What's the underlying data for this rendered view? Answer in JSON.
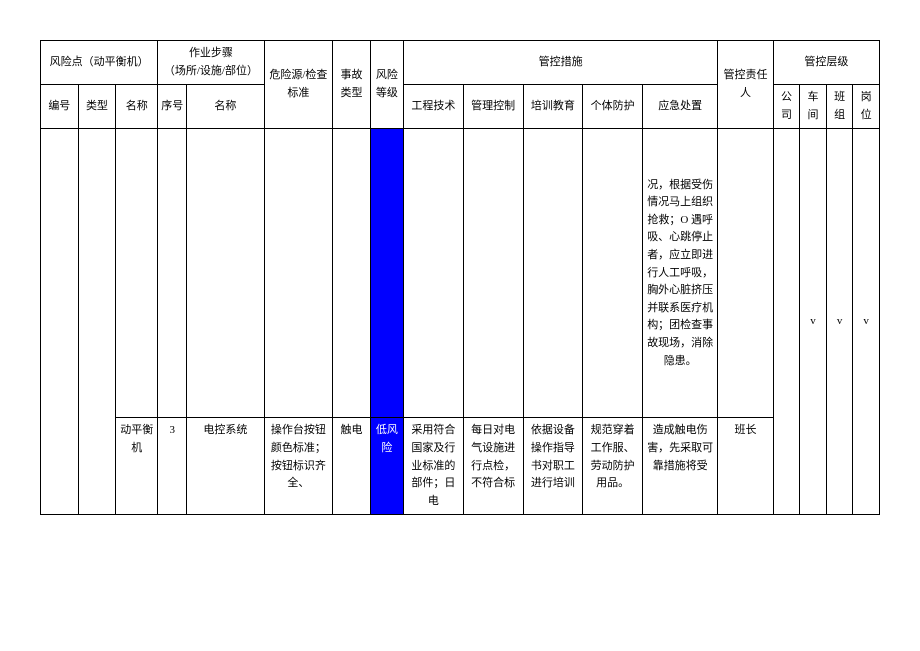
{
  "header": {
    "risk_point_group": "风险点（动平衡机）",
    "operation_steps_group": "作业步骤\n（场所/设施/部位）",
    "hazard_check_standard": "危险源/检查标准",
    "accident_type": "事故类型",
    "risk_level": "风险等级",
    "control_measures_group": "管控措施",
    "control_responsible": "管控责任人",
    "control_level_group": "管控层级",
    "number": "编号",
    "type": "类型",
    "name": "名称",
    "seq": "序号",
    "step_name": "名称",
    "engineering_tech": "工程技术",
    "management_control": "管理控制",
    "training_education": "培训教育",
    "individual_protection": "个体防护",
    "emergency_response": "应急处置",
    "company": "公司",
    "workshop": "车间",
    "team": "班组",
    "post": "岗位"
  },
  "rows": {
    "prev_continuation": {
      "emergency_response": "况，根据受伤情况马上组织抢救；O 遇呼吸、心跳停止者，应立即进行人工呼吸，胸外心脏挤压并联系医疗机构；团检查事故现场，消除隐患。"
    },
    "r1": {
      "name": "动平衡机",
      "seq": "3",
      "step_name": "电控系统",
      "hazard_check_standard": "操作台按钮颜色标准；按钮标识齐全、",
      "accident_type": "触电",
      "risk_level": "低风险",
      "engineering_tech": "采用符合国家及行业标准的部件；日电",
      "management_control": "每日对电气设施进行点检，不符合标",
      "training_education": "依据设备操作指导书对职工进行培训",
      "individual_protection": "规范穿着工作服、劳动防护用品。",
      "emergency_response": "造成触电伤害，先采取可靠措施将受",
      "control_responsible": "班长",
      "company": "",
      "workshop": "v",
      "team": "v",
      "post": "v"
    }
  }
}
